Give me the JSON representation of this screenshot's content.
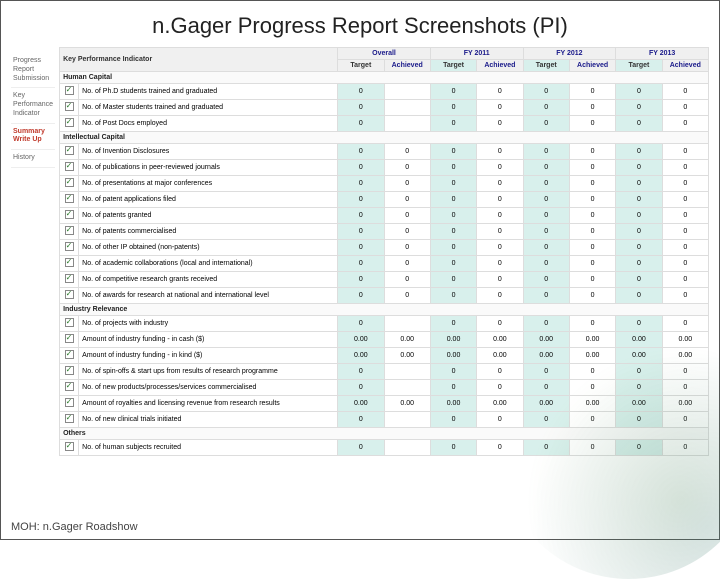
{
  "title": "n.Gager Progress Report Screenshots (PI)",
  "footer": "MOH: n.Gager Roadshow",
  "sidebar": {
    "items": [
      {
        "label": "Progress Report Submission"
      },
      {
        "label": "Key Performance Indicator"
      },
      {
        "label": "Summary Write Up"
      },
      {
        "label": "History"
      }
    ],
    "active_index": 2
  },
  "table": {
    "head_indicator": "Key Performance Indicator",
    "head_overall": "Overall",
    "head_fy": [
      "FY 2011",
      "FY 2012",
      "FY 2013"
    ],
    "head_target": "Target",
    "head_achieved": "Achieved",
    "sections": [
      {
        "name": "Human Capital",
        "rows": [
          {
            "ind": "No. of Ph.D students trained and graduated",
            "vals": [
              "0",
              "",
              "0",
              "0",
              "0",
              "0",
              "0",
              "0"
            ]
          },
          {
            "ind": "No. of Master students trained and graduated",
            "vals": [
              "0",
              "",
              "0",
              "0",
              "0",
              "0",
              "0",
              "0"
            ]
          },
          {
            "ind": "No. of Post Docs employed",
            "vals": [
              "0",
              "",
              "0",
              "0",
              "0",
              "0",
              "0",
              "0"
            ]
          }
        ]
      },
      {
        "name": "Intellectual Capital",
        "rows": [
          {
            "ind": "No. of Invention Disclosures",
            "vals": [
              "0",
              "0",
              "0",
              "0",
              "0",
              "0",
              "0",
              "0"
            ]
          },
          {
            "ind": "No. of publications in peer-reviewed journals",
            "vals": [
              "0",
              "0",
              "0",
              "0",
              "0",
              "0",
              "0",
              "0"
            ]
          },
          {
            "ind": "No. of presentations at major conferences",
            "vals": [
              "0",
              "0",
              "0",
              "0",
              "0",
              "0",
              "0",
              "0"
            ]
          },
          {
            "ind": "No. of patent applications filed",
            "vals": [
              "0",
              "0",
              "0",
              "0",
              "0",
              "0",
              "0",
              "0"
            ]
          },
          {
            "ind": "No. of patents granted",
            "vals": [
              "0",
              "0",
              "0",
              "0",
              "0",
              "0",
              "0",
              "0"
            ]
          },
          {
            "ind": "No. of patents commercialised",
            "vals": [
              "0",
              "0",
              "0",
              "0",
              "0",
              "0",
              "0",
              "0"
            ]
          },
          {
            "ind": "No. of other IP obtained (non-patents)",
            "vals": [
              "0",
              "0",
              "0",
              "0",
              "0",
              "0",
              "0",
              "0"
            ]
          },
          {
            "ind": "No. of academic collaborations (local and international)",
            "vals": [
              "0",
              "0",
              "0",
              "0",
              "0",
              "0",
              "0",
              "0"
            ]
          },
          {
            "ind": "No. of competitive research grants received",
            "vals": [
              "0",
              "0",
              "0",
              "0",
              "0",
              "0",
              "0",
              "0"
            ]
          },
          {
            "ind": "No. of awards for research at national and international level",
            "vals": [
              "0",
              "0",
              "0",
              "0",
              "0",
              "0",
              "0",
              "0"
            ]
          }
        ]
      },
      {
        "name": "Industry Relevance",
        "rows": [
          {
            "ind": "No. of projects with industry",
            "vals": [
              "0",
              "",
              "0",
              "0",
              "0",
              "0",
              "0",
              "0"
            ]
          },
          {
            "ind": "Amount of industry funding - in cash ($)",
            "vals": [
              "0.00",
              "0.00",
              "0.00",
              "0.00",
              "0.00",
              "0.00",
              "0.00",
              "0.00"
            ]
          },
          {
            "ind": "Amount of industry funding - in kind ($)",
            "vals": [
              "0.00",
              "0.00",
              "0.00",
              "0.00",
              "0.00",
              "0.00",
              "0.00",
              "0.00"
            ]
          },
          {
            "ind": "No. of spin-offs & start ups from results of research programme",
            "vals": [
              "0",
              "",
              "0",
              "0",
              "0",
              "0",
              "0",
              "0"
            ]
          },
          {
            "ind": "No. of new products/processes/services commercialised",
            "vals": [
              "0",
              "",
              "0",
              "0",
              "0",
              "0",
              "0",
              "0"
            ]
          },
          {
            "ind": "Amount of royalties and licensing revenue from research results",
            "vals": [
              "0.00",
              "0.00",
              "0.00",
              "0.00",
              "0.00",
              "0.00",
              "0.00",
              "0.00"
            ]
          },
          {
            "ind": "No. of new clinical trials initiated",
            "vals": [
              "0",
              "",
              "0",
              "0",
              "0",
              "0",
              "0",
              "0"
            ]
          }
        ]
      },
      {
        "name": "Others",
        "rows": [
          {
            "ind": "No. of human subjects recruited",
            "vals": [
              "0",
              "",
              "0",
              "0",
              "0",
              "0",
              "0",
              "0"
            ]
          }
        ]
      }
    ]
  }
}
